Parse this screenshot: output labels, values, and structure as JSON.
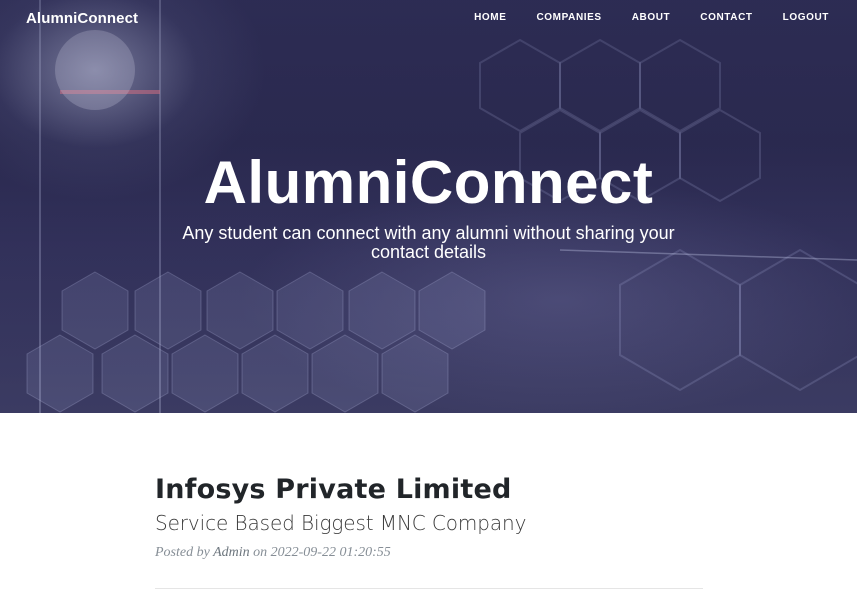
{
  "navbar": {
    "brand": "AlumniConnect",
    "items": [
      {
        "label": "HOME"
      },
      {
        "label": "COMPANIES"
      },
      {
        "label": "ABOUT"
      },
      {
        "label": "CONTACT"
      },
      {
        "label": "LOGOUT"
      }
    ]
  },
  "hero": {
    "title": "AlumniConnect",
    "subtitle": "Any student can connect with any alumni without sharing your contact details"
  },
  "post": {
    "title": "Infosys Private Limited",
    "subtitle": "Service Based Biggest MNC Company",
    "meta_prefix": "Posted by",
    "author": "Admin",
    "meta_on": "on",
    "date": "2022-09-22 01:20:55"
  }
}
